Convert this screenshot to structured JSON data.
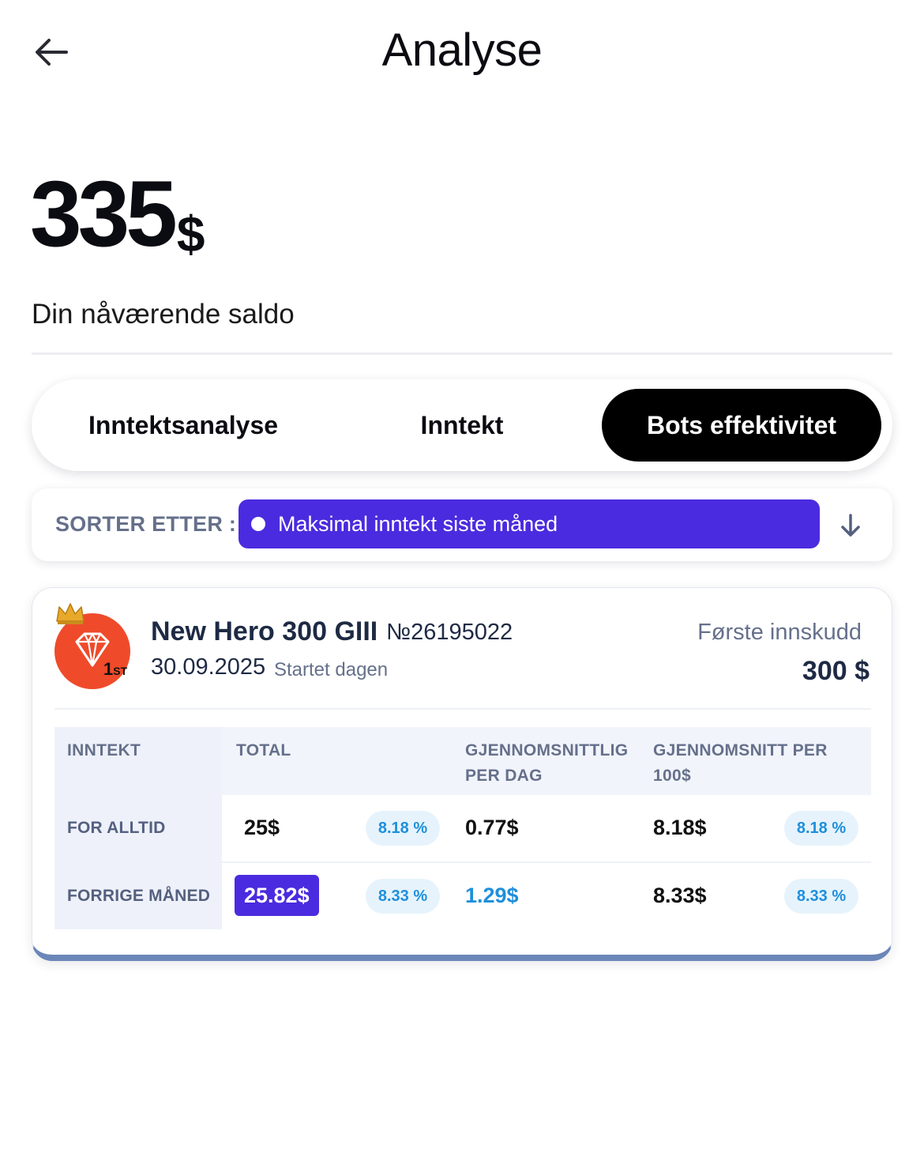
{
  "header": {
    "title": "Analyse",
    "back_icon": "arrow-left-icon"
  },
  "balance": {
    "amount": "335",
    "currency": "$",
    "label": "Din nåværende saldo"
  },
  "tabs": [
    {
      "label": "Inntektsanalyse",
      "active": false
    },
    {
      "label": "Inntekt",
      "active": false
    },
    {
      "label": "Bots effektivitet",
      "active": true
    }
  ],
  "sort": {
    "label": "SORTER ETTER :",
    "selected": "Maksimal inntekt siste måned",
    "icon": "arrow-down-icon",
    "accent": "#4b2bdf"
  },
  "bot": {
    "name": "New Hero 300 GIII",
    "id": "№26195022",
    "date": "30.09.2025",
    "started_label": "Startet dagen",
    "rank": "1",
    "rank_suffix": "ST",
    "logo_icon": "diamond-icon",
    "crown_icon": "crown-icon",
    "first_deposit_label": "Første innskudd",
    "first_deposit_value": "300 $",
    "logo_color": "#ef4b2b"
  },
  "table": {
    "headers": [
      "INNTEKT",
      "TOTAL",
      "GJENNOMSNITTLIG PER DAG",
      "GJENNOMSNITT PER 100$"
    ],
    "rows": [
      {
        "label": "FOR ALLTID",
        "total": "25$",
        "total_pct": "8.18 %",
        "per_day": "0.77$",
        "per_100": "8.18$",
        "per_100_pct": "8.18 %"
      },
      {
        "label": "FORRIGE MÅNED",
        "total": "25.82$",
        "total_pct": "8.33 %",
        "per_day": "1.29$",
        "per_100": "8.33$",
        "per_100_pct": "8.33 %"
      }
    ]
  }
}
